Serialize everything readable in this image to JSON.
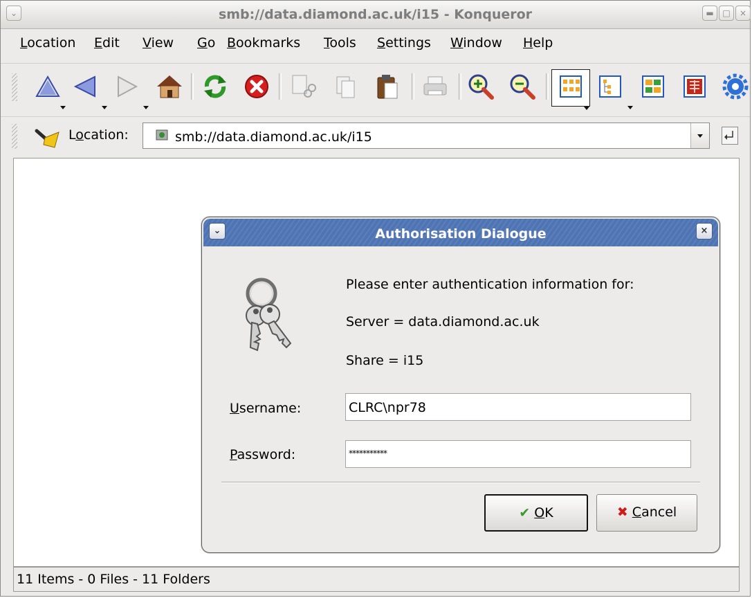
{
  "window": {
    "title": "smb://data.diamond.ac.uk/i15 - Konqueror"
  },
  "menubar": {
    "items": [
      {
        "label": "Location",
        "accel": "L",
        "rest": "ocation"
      },
      {
        "label": "Edit",
        "accel": "E",
        "rest": "dit"
      },
      {
        "label": "View",
        "accel": "V",
        "rest": "iew"
      },
      {
        "label": "Go",
        "accel": "G",
        "rest": "o"
      },
      {
        "label": "Bookmarks",
        "accel": "B",
        "rest": "ookmarks"
      },
      {
        "label": "Tools",
        "accel": "T",
        "rest": "ools"
      },
      {
        "label": "Settings",
        "accel": "S",
        "rest": "ettings"
      },
      {
        "label": "Window",
        "accel": "W",
        "rest": "indow"
      },
      {
        "label": "Help",
        "accel": "H",
        "rest": "elp"
      }
    ]
  },
  "toolbar": {
    "icons": [
      "up-arrow-icon",
      "back-arrow-icon",
      "forward-arrow-icon",
      "home-icon",
      "reload-icon",
      "stop-icon",
      "cut-icon",
      "copy-icon",
      "paste-icon",
      "print-icon",
      "zoom-in-icon",
      "zoom-out-icon",
      "icon-view-icon",
      "tree-view-icon",
      "multi-column-view-icon",
      "detailed-view-icon",
      "settings-gear-icon"
    ]
  },
  "locationbar": {
    "label_accel": "o",
    "label_pre": "L",
    "label_post": "cation:",
    "url": "smb://data.diamond.ac.uk/i15"
  },
  "statusbar": {
    "text": "11 Items - 0 Files - 11 Folders"
  },
  "dialog": {
    "title": "Authorisation Dialogue",
    "prompt": "Please enter authentication information for:",
    "server": "Server = data.diamond.ac.uk",
    "share": "Share = i15",
    "username_label_accel": "U",
    "username_label_rest": "sername:",
    "username_value": "CLRC\\npr78",
    "password_label_accel": "P",
    "password_label_rest": "assword:",
    "password_value": "***********",
    "ok_accel": "O",
    "ok_rest": "K",
    "cancel_accel": "C",
    "cancel_rest": "ancel"
  },
  "colors": {
    "dialog_title_bg": "#4f74b3",
    "ok_check": "#3a9a2a",
    "cancel_x": "#d01b1b"
  }
}
